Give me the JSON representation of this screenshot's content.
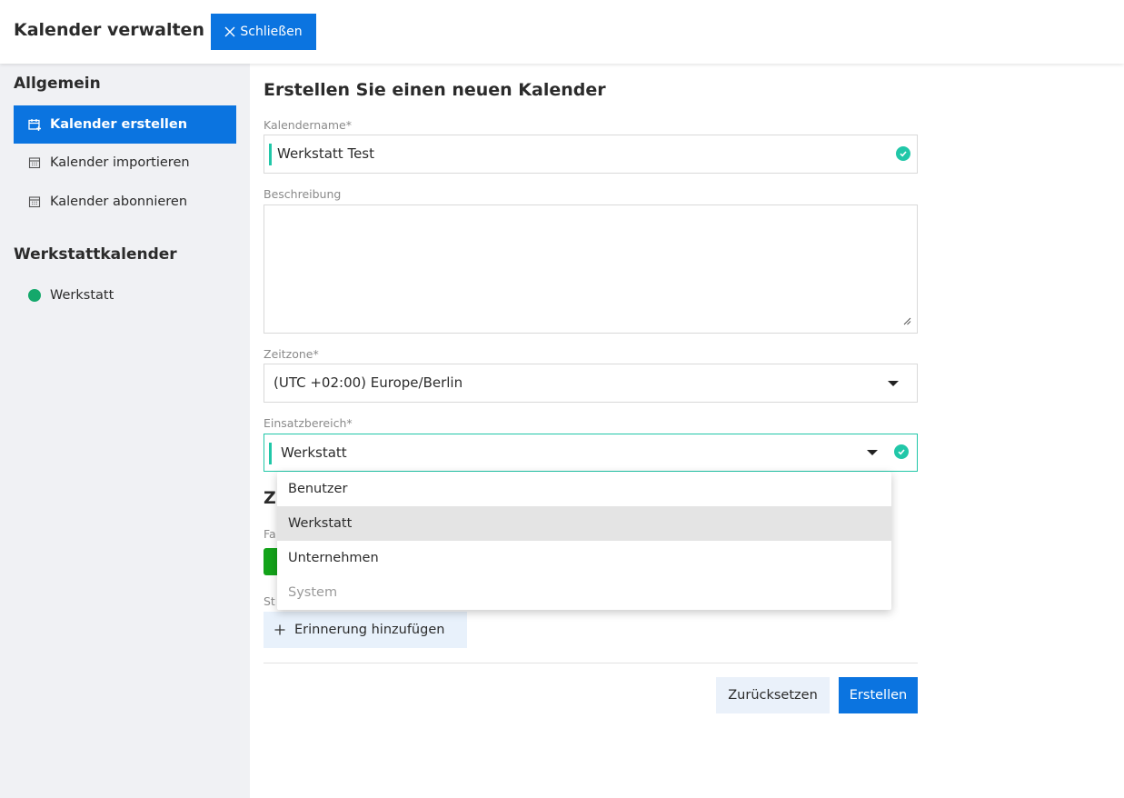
{
  "header": {
    "title": "Kalender verwalten",
    "close_label": "Schließen"
  },
  "sidebar": {
    "section1_title": "Allgemein",
    "items": [
      {
        "label": "Kalender erstellen",
        "icon": "calendar-plus-icon",
        "active": true
      },
      {
        "label": "Kalender importieren",
        "icon": "calendar-icon",
        "active": false
      },
      {
        "label": "Kalender abonnieren",
        "icon": "calendar-icon",
        "active": false
      }
    ],
    "section2_title": "Werkstattkalender",
    "calendars": [
      {
        "label": "Werkstatt",
        "color": "#14a86b"
      }
    ]
  },
  "main": {
    "title": "Erstellen Sie einen neuen Kalender",
    "name_label": "Kalendername*",
    "name_value": "Werkstatt Test",
    "description_label": "Beschreibung",
    "description_value": "",
    "timezone_label": "Zeitzone*",
    "timezone_value": "(UTC +02:00) Europe/Berlin",
    "scope_label": "Einsatzbereich*",
    "scope_value": "Werkstatt",
    "partial_heading": "Z",
    "partial_label1": "Fa",
    "partial_label2": "St",
    "color_swatch": "#13a31a",
    "add_reminder_label": "Erinnerung hinzufügen",
    "reset_label": "Zurücksetzen",
    "create_label": "Erstellen"
  },
  "dropdown": {
    "options": [
      {
        "label": "Benutzer",
        "state": "normal"
      },
      {
        "label": "Werkstatt",
        "state": "selected"
      },
      {
        "label": "Unternehmen",
        "state": "normal"
      },
      {
        "label": "System",
        "state": "disabled"
      }
    ]
  },
  "colors": {
    "primary": "#0b74e0",
    "valid": "#21c7a8",
    "sidebar_bg": "#f0f1f4"
  }
}
